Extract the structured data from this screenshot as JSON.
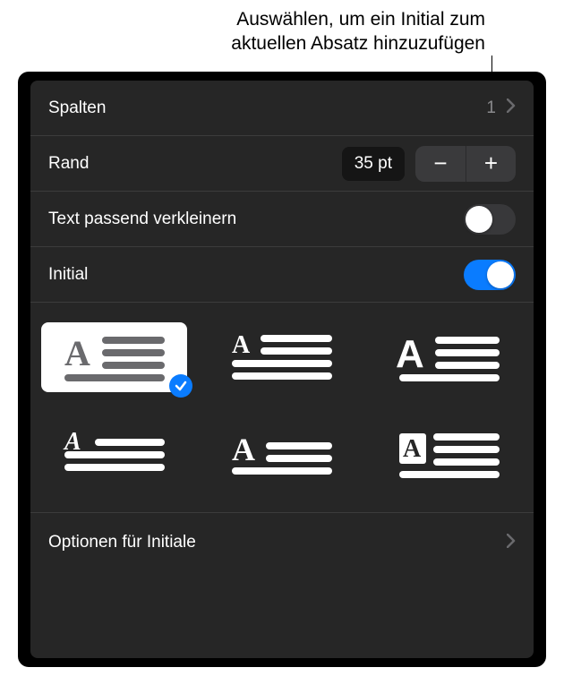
{
  "annotation": {
    "line1": "Auswählen, um ein Initial zum",
    "line2": "aktuellen Absatz hinzuzufügen"
  },
  "rows": {
    "columns": {
      "label": "Spalten",
      "value": "1"
    },
    "margin": {
      "label": "Rand",
      "value": "35 pt"
    },
    "shrink": {
      "label": "Text passend verkleinern",
      "on": false
    },
    "initial": {
      "label": "Initial",
      "on": true
    }
  },
  "options_row": {
    "label": "Optionen für Initiale"
  }
}
